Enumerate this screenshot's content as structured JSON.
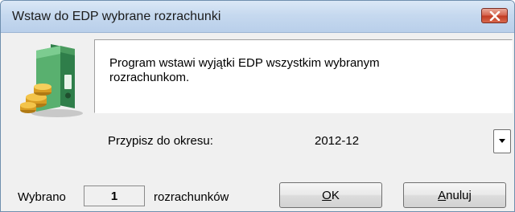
{
  "window": {
    "title": "Wstaw do EDP wybrane rozrachunki",
    "close_icon": "close-icon",
    "close_color": "#c7432b"
  },
  "message": {
    "line1": "Program wstawi wyjątki EDP wszystkim wybranym",
    "line2": "rozrachunkom."
  },
  "period": {
    "label": "Przypisz do okresu:",
    "value": "2012-12",
    "dropdown_icon": "chevron-down-icon"
  },
  "footer": {
    "selected_prefix": "Wybrano",
    "selected_count": "1",
    "selected_suffix": "rozrachunków",
    "ok_first": "O",
    "ok_rest": "K",
    "cancel_first": "A",
    "cancel_rest": "nuluj"
  },
  "app_icon": "ledger-binder-coins-icon"
}
